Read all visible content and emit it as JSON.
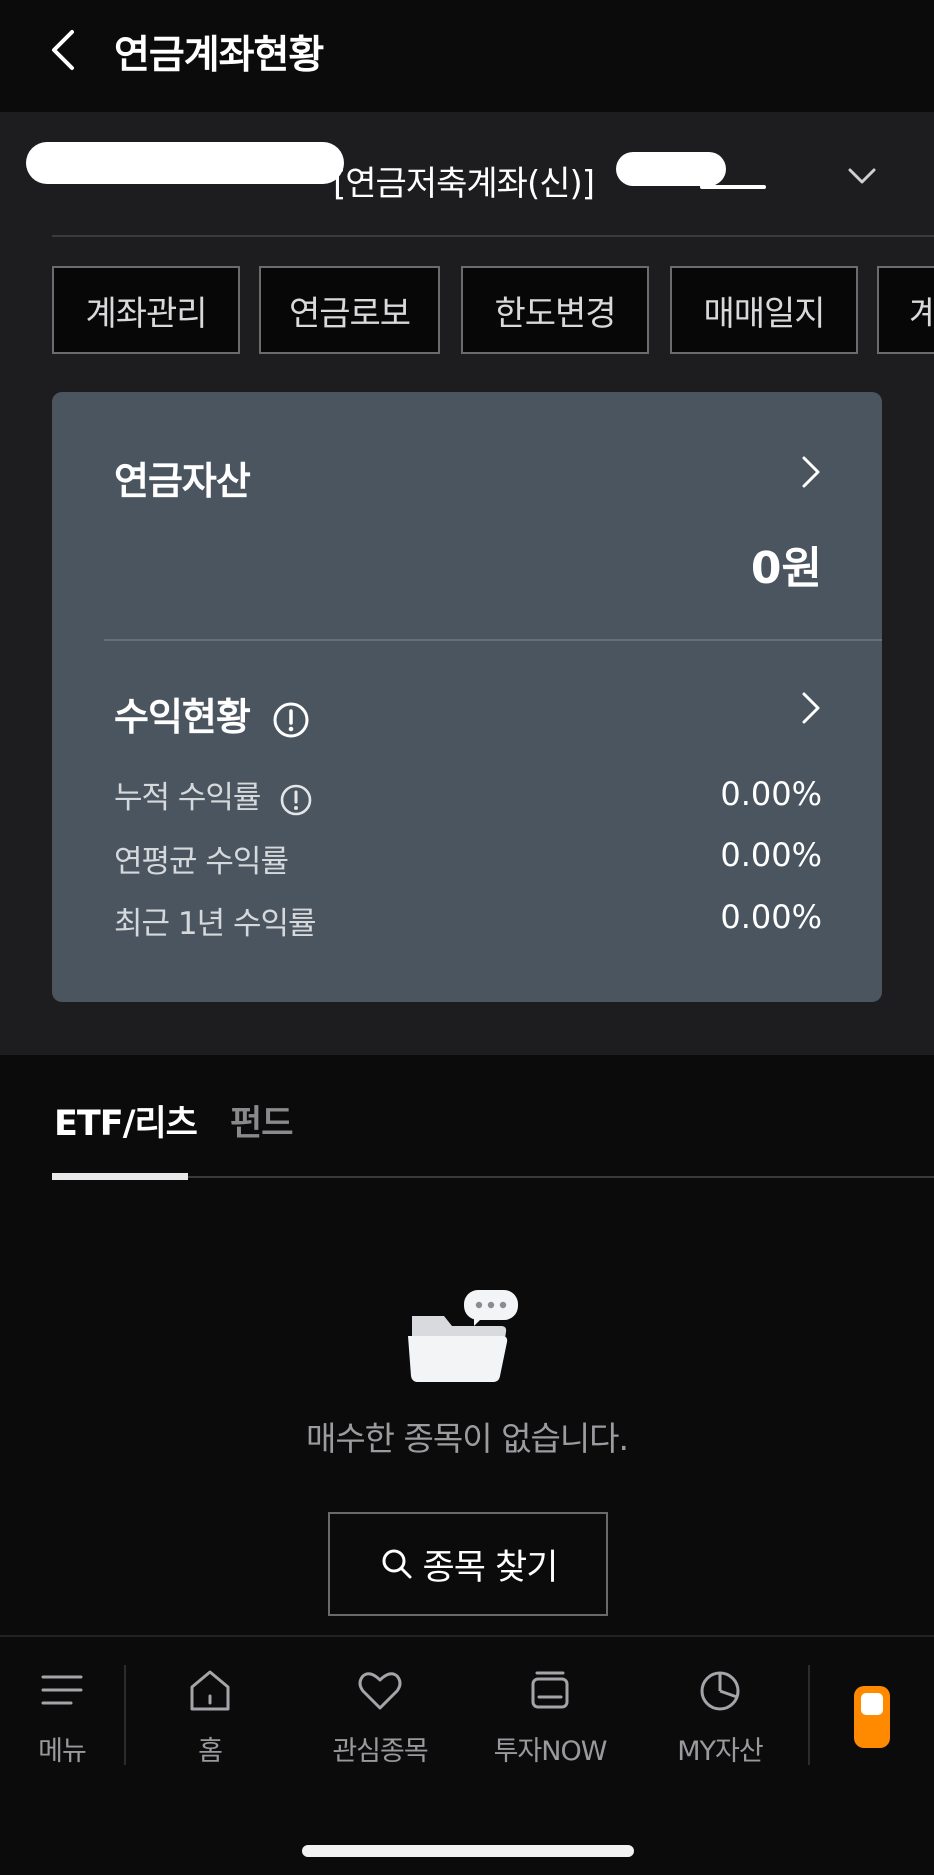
{
  "header": {
    "title": "연금계좌현황"
  },
  "account": {
    "name": "[연금저축계좌(신)]"
  },
  "chips": [
    "계좌관리",
    "연금로보",
    "한도변경",
    "매매일지",
    "계"
  ],
  "card": {
    "asset_title": "연금자산",
    "asset_amount": "0원",
    "profit_title": "수익현황",
    "rows": [
      {
        "label": "누적 수익률",
        "value": "0.00%"
      },
      {
        "label": "연평균 수익률",
        "value": "0.00%"
      },
      {
        "label": "최근 1년 수익률",
        "value": "0.00%"
      }
    ]
  },
  "tabs": [
    {
      "label": "ETF/리츠",
      "active": true
    },
    {
      "label": "펀드",
      "active": false
    }
  ],
  "empty_state": {
    "message": "매수한 종목이 없습니다.",
    "button_label": "종목 찾기"
  },
  "bottom_nav": [
    {
      "label": "메뉴",
      "icon": "menu-icon"
    },
    {
      "label": "홈",
      "icon": "home-icon"
    },
    {
      "label": "관심종목",
      "icon": "heart-icon"
    },
    {
      "label": "투자NOW",
      "icon": "investment-now-icon"
    },
    {
      "label": "MY자산",
      "icon": "pie-chart-icon"
    }
  ],
  "colors": {
    "background": "#0b0b0c",
    "panel": "#1d1d1f",
    "card": "#4b5560",
    "accent": "#ff8a00"
  }
}
